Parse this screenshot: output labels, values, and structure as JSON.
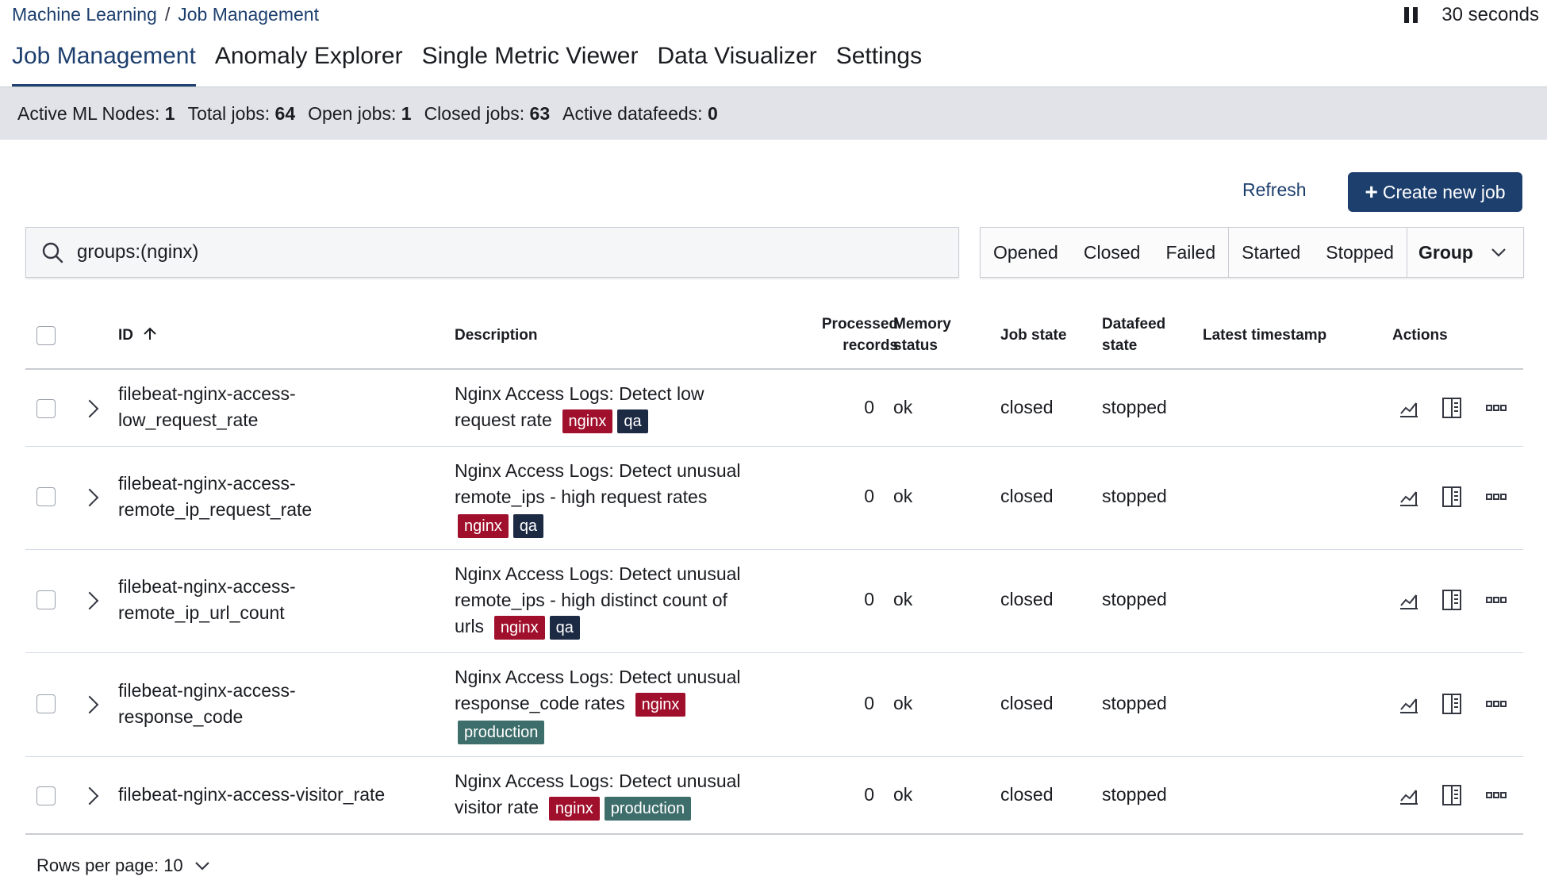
{
  "breadcrumb": {
    "items": [
      "Machine Learning",
      "Job Management"
    ],
    "separator": "/"
  },
  "refresh_interval": {
    "label": "30 seconds"
  },
  "tabs": [
    {
      "label": "Job Management",
      "selected": true
    },
    {
      "label": "Anomaly Explorer",
      "selected": false
    },
    {
      "label": "Single Metric Viewer",
      "selected": false
    },
    {
      "label": "Data Visualizer",
      "selected": false
    },
    {
      "label": "Settings",
      "selected": false
    }
  ],
  "stats": [
    {
      "label": "Active ML Nodes:",
      "value": "1"
    },
    {
      "label": "Total jobs:",
      "value": "64"
    },
    {
      "label": "Open jobs:",
      "value": "1"
    },
    {
      "label": "Closed jobs:",
      "value": "63"
    },
    {
      "label": "Active datafeeds:",
      "value": "0"
    }
  ],
  "toolbar": {
    "refresh_label": "Refresh",
    "create_label": "Create new job"
  },
  "search": {
    "value": "groups:(nginx)"
  },
  "filters": {
    "state": [
      "Opened",
      "Closed",
      "Failed"
    ],
    "datafeed": [
      "Started",
      "Stopped"
    ],
    "group_label": "Group"
  },
  "table": {
    "headers": {
      "id": "ID",
      "description": "Description",
      "processed_1": "Processed",
      "processed_2": "records",
      "memory_1": "Memory",
      "memory_2": "status",
      "job_state": "Job state",
      "datafeed_1": "Datafeed",
      "datafeed_2": "state",
      "latest": "Latest timestamp",
      "actions": "Actions"
    },
    "rows": [
      {
        "id_lines": [
          "filebeat-nginx-access-",
          "low_request_rate"
        ],
        "desc_lines": [
          "Nginx Access Logs: Detect low",
          "request rate"
        ],
        "badges": [
          [
            "nginx",
            "qa"
          ]
        ],
        "processed": "0",
        "memory": "ok",
        "job_state": "closed",
        "datafeed_state": "stopped"
      },
      {
        "id_lines": [
          "filebeat-nginx-access-",
          "remote_ip_request_rate"
        ],
        "desc_lines": [
          "Nginx Access Logs: Detect unusual",
          "remote_ips - high request rates"
        ],
        "badges": [
          [
            "nginx",
            "qa"
          ]
        ],
        "processed": "0",
        "memory": "ok",
        "job_state": "closed",
        "datafeed_state": "stopped"
      },
      {
        "id_lines": [
          "filebeat-nginx-access-",
          "remote_ip_url_count"
        ],
        "desc_lines": [
          "Nginx Access Logs: Detect unusual",
          "remote_ips - high distinct count of",
          "urls"
        ],
        "badges": [
          [
            "nginx",
            "qa"
          ]
        ],
        "processed": "0",
        "memory": "ok",
        "job_state": "closed",
        "datafeed_state": "stopped"
      },
      {
        "id_lines": [
          "filebeat-nginx-access-",
          "response_code"
        ],
        "desc_lines": [
          "Nginx Access Logs: Detect unusual",
          "response_code rates"
        ],
        "badges": [
          [
            "nginx"
          ],
          [
            "production"
          ]
        ],
        "processed": "0",
        "memory": "ok",
        "job_state": "closed",
        "datafeed_state": "stopped"
      },
      {
        "id_lines": [
          "filebeat-nginx-access-visitor_rate"
        ],
        "desc_lines": [
          "Nginx Access Logs: Detect unusual",
          "visitor rate"
        ],
        "badges": [
          [
            "nginx",
            "production"
          ]
        ],
        "processed": "0",
        "memory": "ok",
        "job_state": "closed",
        "datafeed_state": "stopped"
      }
    ]
  },
  "pagination": {
    "rows_per_page_label": "Rows per page: 10"
  },
  "colors": {
    "primary": "#1d3f6e",
    "badge_nginx": "#a0102c",
    "badge_qa": "#1d2a44",
    "badge_production": "#3e6e6b",
    "stats_bg": "#e1e3e8"
  },
  "icons": [
    "pause-icon",
    "plus-icon",
    "search-icon",
    "chevron-down-icon",
    "chevron-right-icon",
    "sort-up-icon",
    "chart-icon",
    "table-icon",
    "more-icon"
  ]
}
